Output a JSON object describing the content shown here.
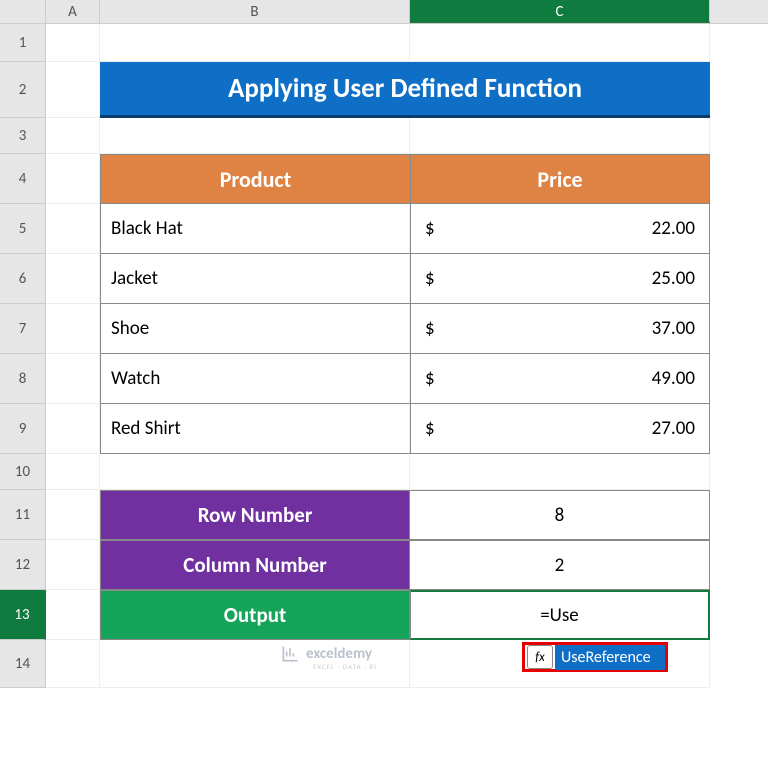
{
  "columns": {
    "A": "A",
    "B": "B",
    "C": "C"
  },
  "rows": [
    "1",
    "2",
    "3",
    "4",
    "5",
    "6",
    "7",
    "8",
    "9",
    "10",
    "11",
    "12",
    "13",
    "14"
  ],
  "title": "Applying User Defined Function",
  "table": {
    "headers": {
      "product": "Product",
      "price": "Price"
    },
    "rows": [
      {
        "product": "Black Hat",
        "currency": "$",
        "price": "22.00"
      },
      {
        "product": "Jacket",
        "currency": "$",
        "price": "25.00"
      },
      {
        "product": "Shoe",
        "currency": "$",
        "price": "37.00"
      },
      {
        "product": "Watch",
        "currency": "$",
        "price": "49.00"
      },
      {
        "product": "Red Shirt",
        "currency": "$",
        "price": "27.00"
      }
    ]
  },
  "params": {
    "row_label": "Row Number",
    "row_value": "8",
    "col_label": "Column Number",
    "col_value": "2",
    "out_label": "Output",
    "out_value": "=Use"
  },
  "autocomplete": {
    "fx": "fx",
    "item": "UseReference"
  },
  "watermark": {
    "brand": "exceldemy",
    "sub": "EXCEL · DATA · BI"
  },
  "chart_data": {
    "type": "table",
    "title": "Applying User Defined Function",
    "columns": [
      "Product",
      "Price"
    ],
    "rows": [
      [
        "Black Hat",
        22.0
      ],
      [
        "Jacket",
        25.0
      ],
      [
        "Shoe",
        37.0
      ],
      [
        "Watch",
        49.0
      ],
      [
        "Red Shirt",
        27.0
      ]
    ],
    "params": {
      "Row Number": 8,
      "Column Number": 2,
      "Output": "=Use"
    }
  }
}
